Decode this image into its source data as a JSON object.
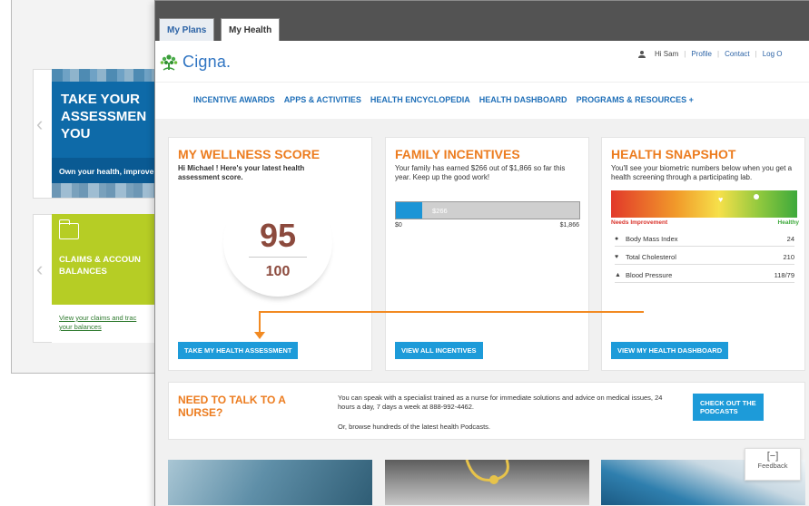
{
  "background_page": {
    "blue_card": {
      "heading": "TAKE YOUR ASSESSMENT YOU",
      "heading_lines": [
        "TAKE YOUR",
        "ASSESSMEN",
        "YOU"
      ],
      "band_text": "Own your health, improve"
    },
    "green_card": {
      "heading_lines": [
        "CLAIMS & ACCOUN",
        "BALANCES"
      ],
      "link_lines": [
        "View your claims and trac",
        "your balances"
      ]
    }
  },
  "tabs": [
    {
      "label": "My Plans"
    },
    {
      "label": "My Health"
    }
  ],
  "header": {
    "logo_text": "Cigna.",
    "greeting": "Hi Sam",
    "links": [
      "Profile",
      "Contact",
      "Log O"
    ]
  },
  "nav": [
    "INCENTIVE AWARDS",
    "APPS & ACTIVITIES",
    "HEALTH ENCYCLOPEDIA",
    "HEALTH DASHBOARD",
    "PROGRAMS & RESOURCES +"
  ],
  "wellness": {
    "title": "MY WELLNESS SCORE",
    "subtitle": "Hi Michael ! Here's your latest health assessment score.",
    "score": "95",
    "max_score": "100",
    "button": "TAKE MY HEALTH ASSESSMENT"
  },
  "incentives": {
    "title": "FAMILY INCENTIVES",
    "subtitle": "Your family has earned $266 out of $1,866 so far this year.  Keep up the good work!",
    "earned_label": "$266",
    "min_label": "$0",
    "max_label": "$1,866",
    "progress_fraction": 0.143,
    "button": "VIEW ALL INCENTIVES"
  },
  "snapshot": {
    "title": "HEALTH SNAPSHOT",
    "subtitle": "You'll see your biometric numbers below when you get a health screening through a participating lab.",
    "scale_left": "Needs Improvement",
    "scale_right": "Healthy",
    "metrics": [
      {
        "icon": "circle-icon",
        "label": "Body Mass Index",
        "value": "24"
      },
      {
        "icon": "heart-icon",
        "label": "Total Cholesterol",
        "value": "210"
      },
      {
        "icon": "triangle-icon",
        "label": "Blood Pressure",
        "value": "118/79"
      }
    ],
    "button": "VIEW MY HEALTH DASHBOARD"
  },
  "nurse": {
    "title": "NEED TO TALK TO A NURSE?",
    "text": "You can speak with a specialist trained as a nurse for immediate solutions and advice on medical issues, 24 hours a day, 7 days a week at 888-992-4462.",
    "text2": "Or, browse hundreds of the latest health Podcasts.",
    "button": "CHECK OUT THE PODCASTS"
  },
  "feedback": {
    "icon": "[−]",
    "label": "Feedback"
  },
  "colors": {
    "accent_orange": "#ec7c1f",
    "button_blue": "#1d9bd9",
    "nav_blue": "#1f6fb8",
    "topbar": "#535353"
  }
}
